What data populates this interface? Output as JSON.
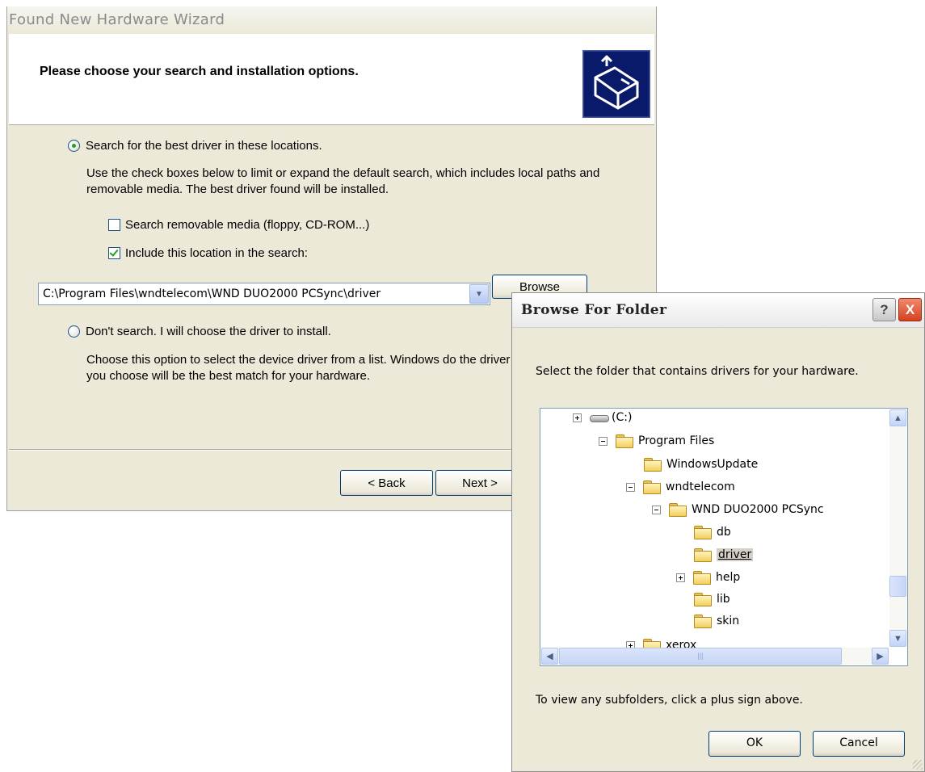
{
  "wizard": {
    "title": "Found New Hardware Wizard",
    "heading": "Please choose your search and installation options.",
    "option_search_label": "Search for the best driver in these locations.",
    "option_search_selected": true,
    "search_description": "Use the check boxes below to limit or expand the default search, which includes local paths and removable media. The best driver found will be installed.",
    "removable_media_label": "Search removable media (floppy, CD-ROM...)",
    "removable_media_checked": false,
    "include_location_label": "Include this location in the search:",
    "include_location_checked": true,
    "location_value": "C:\\Program Files\\wndtelecom\\WND DUO2000 PCSync\\driver",
    "browse_button": "Browse",
    "option_dont_search_label": "Don't search. I will choose the driver to install.",
    "option_dont_search_selected": false,
    "dont_search_description": "Choose this option to select the device driver from a list.  Windows do the driver you choose will be the best match for your hardware.",
    "back_button": "< Back",
    "next_button": "Next >"
  },
  "browse_dialog": {
    "title": "Browse For Folder",
    "help_button": "?",
    "close_button": "X",
    "instruction": "Select the folder that contains drivers for your hardware.",
    "tree": [
      {
        "label": "(C:)",
        "expander": "plus",
        "icon": "drive-icon"
      },
      {
        "label": "Program Files",
        "expander": "minus",
        "icon": "folder-icon"
      },
      {
        "label": "WindowsUpdate",
        "expander": "none",
        "icon": "folder-icon"
      },
      {
        "label": "wndtelecom",
        "expander": "minus",
        "icon": "folder-icon"
      },
      {
        "label": "WND DUO2000 PCSync",
        "expander": "minus",
        "icon": "folder-icon"
      },
      {
        "label": "db",
        "expander": "none",
        "icon": "folder-icon"
      },
      {
        "label": "driver",
        "expander": "none",
        "icon": "folder-icon",
        "selected": true
      },
      {
        "label": "help",
        "expander": "plus",
        "icon": "folder-icon"
      },
      {
        "label": "lib",
        "expander": "none",
        "icon": "folder-icon"
      },
      {
        "label": "skin",
        "expander": "none",
        "icon": "folder-icon"
      },
      {
        "label": "xerox",
        "expander": "plus",
        "icon": "folder-icon"
      }
    ],
    "hint": "To view any subfolders, click a plus sign above.",
    "ok_button": "OK",
    "cancel_button": "Cancel"
  }
}
